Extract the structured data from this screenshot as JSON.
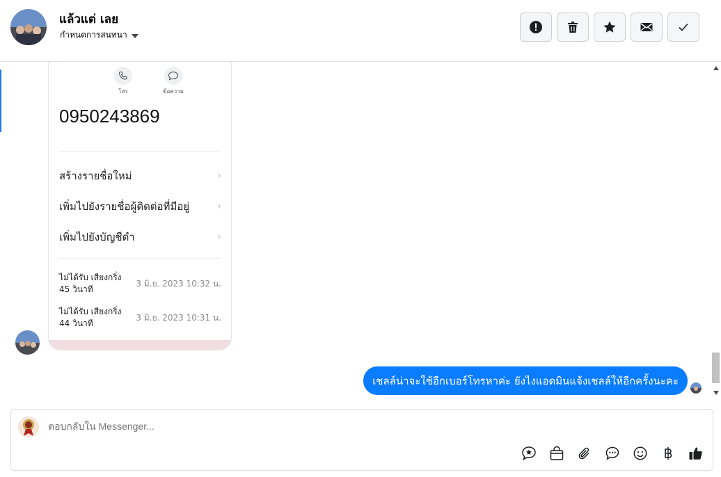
{
  "header": {
    "contact_name": "แล้วแต่ เลย",
    "subtitle": "กำหนดการสนทนา",
    "actions": [
      {
        "name": "report-button",
        "icon": "exclamation-icon"
      },
      {
        "name": "delete-button",
        "icon": "trash-icon"
      },
      {
        "name": "star-button",
        "icon": "star-icon"
      },
      {
        "name": "mark-unread-button",
        "icon": "envelope-icon"
      },
      {
        "name": "mark-done-button",
        "icon": "check-icon"
      }
    ]
  },
  "attachment": {
    "icons": [
      {
        "icon": "phone-icon",
        "label": "โทร"
      },
      {
        "icon": "chat-bubble-icon",
        "label": "ข้อความ"
      }
    ],
    "phone_number": "0950243869",
    "options": [
      "สร้างรายชื่อใหม่",
      "เพิ่มไปยังรายชื่อผู้ติดต่อที่มีอยู่",
      "เพิ่มไปยังบัญชีดำ"
    ],
    "calls": [
      {
        "line1": "ไม่ได้รับ เสียงกริ่ง",
        "line2": "45 วินาที",
        "date": "3 มิ.ย. 2023 10:32 น."
      },
      {
        "line1": "ไม่ได้รับ เสียงกริ่ง",
        "line2": "44 วินาที",
        "date": "3 มิ.ย. 2023 10:31 น."
      }
    ]
  },
  "message": {
    "text": "เชลล์น่าจะใช้อีกเบอร์โทรหาค่ะ  ยังไงแอดมินแจ้งเชลล์ให้อีกครั้งนะคะ"
  },
  "composer": {
    "placeholder": "ตอบกลับใน Messenger...",
    "tools": [
      "saved-reply-icon",
      "shop-bag-icon",
      "attach-icon",
      "faq-icon",
      "emoji-icon",
      "baht-icon",
      "like-icon"
    ]
  },
  "colors": {
    "accent": "#1877f2",
    "bubble": "#0a7cff"
  }
}
